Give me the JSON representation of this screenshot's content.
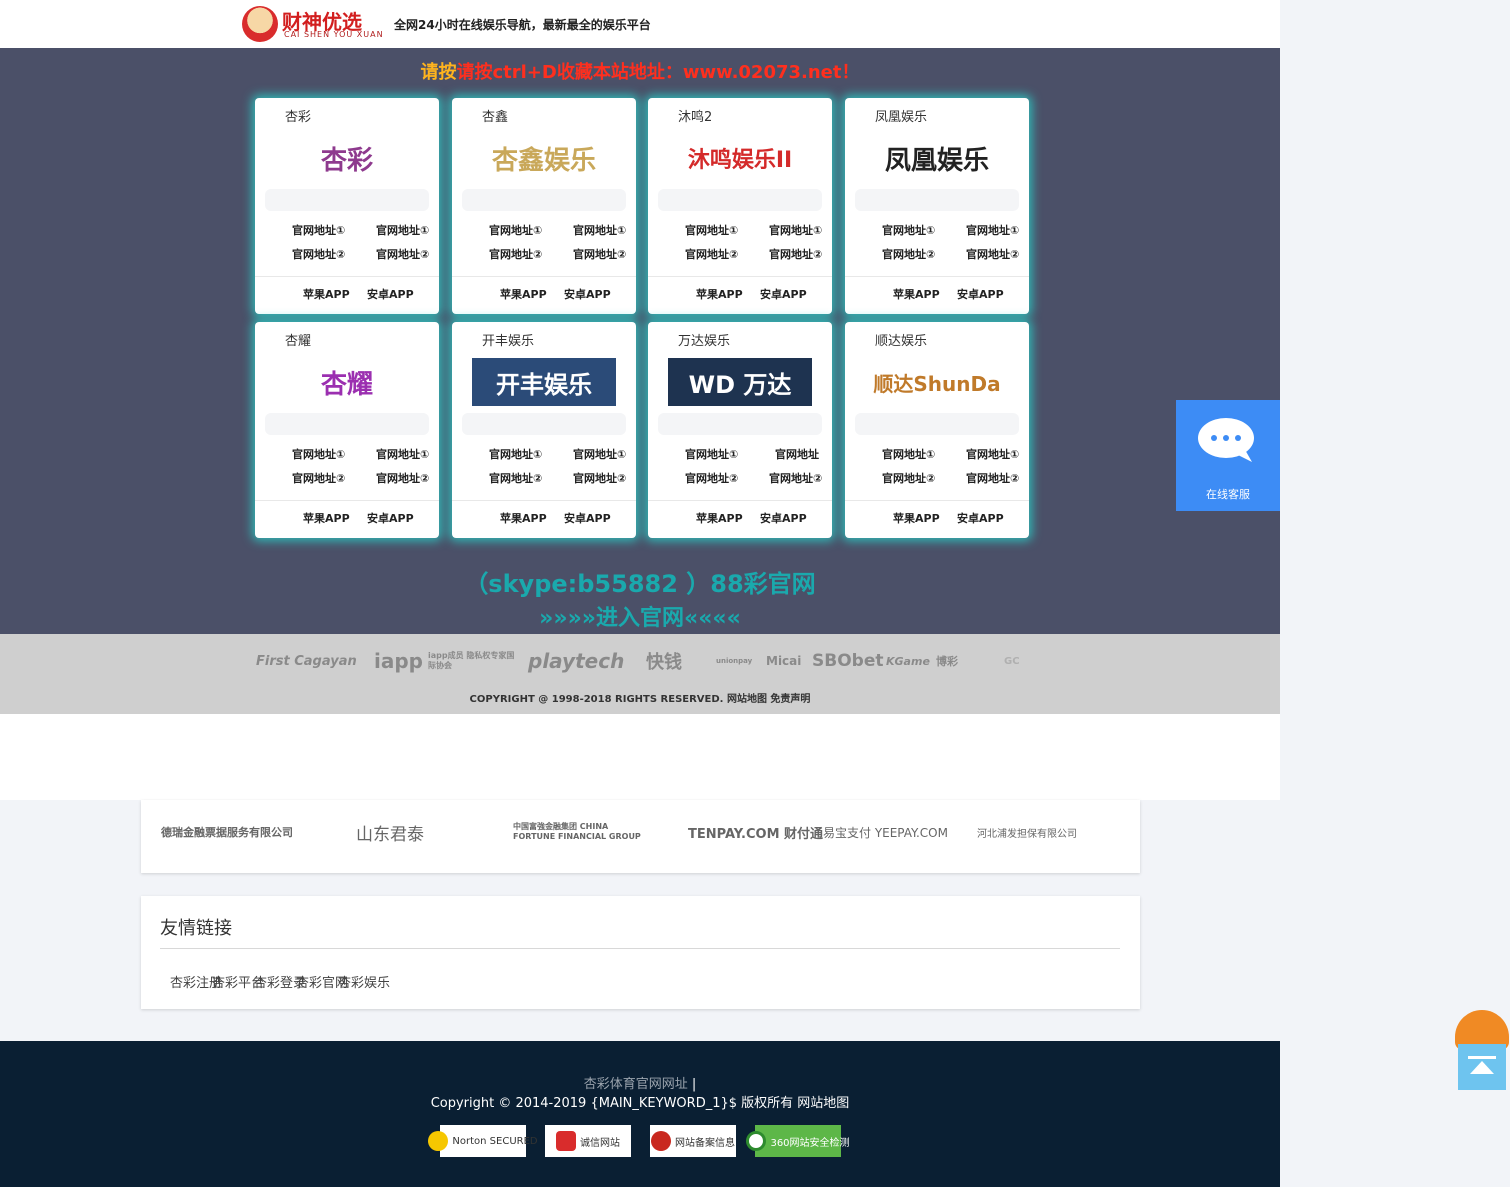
{
  "header": {
    "logo_text": "财神优选",
    "logo_sub": "CAI SHEN YOU XUAN",
    "tagline": "全网24小时在线娱乐导航，最新最全的娱乐平台"
  },
  "notice": {
    "part1": "请按",
    "part2": "请按ctrl+D收藏本站地址：www.02073.net！"
  },
  "cards": [
    {
      "name": "杏彩",
      "logo": "杏彩",
      "l1": "官网地址①",
      "l2": "官网地址①",
      "l3": "官网地址②",
      "l4": "官网地址②",
      "app1": "苹果APP",
      "app2": "安卓APP",
      "color": "#8e3a8e"
    },
    {
      "name": "杏鑫",
      "logo": "杏鑫娱乐",
      "l1": "官网地址①",
      "l2": "官网地址①",
      "l3": "官网地址②",
      "l4": "官网地址②",
      "app1": "苹果APP",
      "app2": "安卓APP",
      "color": "#c9a85a"
    },
    {
      "name": "沐鸣2",
      "logo": "沐鸣娱乐II",
      "l1": "官网地址①",
      "l2": "官网地址①",
      "l3": "官网地址②",
      "l4": "官网地址②",
      "app1": "苹果APP",
      "app2": "安卓APP",
      "color": "#d42a2a"
    },
    {
      "name": "凤凰娱乐",
      "logo": "凤凰娱乐",
      "l1": "官网地址①",
      "l2": "官网地址①",
      "l3": "官网地址②",
      "l4": "官网地址②",
      "app1": "苹果APP",
      "app2": "安卓APP",
      "color": "#222222"
    },
    {
      "name": "杏耀",
      "logo": "杏耀",
      "l1": "官网地址①",
      "l2": "官网地址①",
      "l3": "官网地址②",
      "l4": "官网地址②",
      "app1": "苹果APP",
      "app2": "安卓APP",
      "color": "#9b2fb0"
    },
    {
      "name": "开丰娱乐",
      "logo": "开丰娱乐",
      "l1": "官网地址①",
      "l2": "官网地址①",
      "l3": "官网地址②",
      "l4": "官网地址②",
      "app1": "苹果APP",
      "app2": "安卓APP",
      "color": "#ffffff"
    },
    {
      "name": "万达娱乐",
      "logo": "WD 万达",
      "l1": "官网地址①",
      "l2": "官网地址",
      "l3": "官网地址②",
      "l4": "官网地址②",
      "app1": "苹果APP",
      "app2": "安卓APP",
      "color": "#ffffff"
    },
    {
      "name": "顺达娱乐",
      "logo": "顺达ShunDa",
      "l1": "官网地址①",
      "l2": "官网地址①",
      "l3": "官网地址②",
      "l4": "官网地址②",
      "app1": "苹果APP",
      "app2": "安卓APP",
      "color": "#c07a2a"
    }
  ],
  "contact": {
    "skype": "（skype:b55882 ）88彩官网",
    "enter": "»»»»进入官网««««"
  },
  "partner_logos": [
    "First Cagayan",
    "iapp",
    "iapp成员 隐私权专家国际协会",
    "playtech",
    "快钱",
    "unionpay",
    "Micai",
    "SBObet",
    "KGame",
    "博彩",
    "GC"
  ],
  "copyright1": "COPYRIGHT @ 1998-2018 RIGHTS RESERVED. 网站地图 免责声明",
  "finance_logos": [
    "德瑞金融票据服务有限公司",
    "山东君泰",
    "中国富強金融集团 CHINA FORTUNE FINANCIAL GROUP",
    "TENPAY.COM 财付通",
    "易宝支付 YEEPAY.COM",
    "河北浦发担保有限公司"
  ],
  "friend_links": {
    "title": "友情链接",
    "items": [
      "杏彩注册",
      "杏彩平台",
      "杏彩登录",
      "杏彩官网",
      "杏彩娱乐"
    ]
  },
  "footer": {
    "link": "杏彩体育官网网址",
    "pipe": " |",
    "copyright": "Copyright © 2014-2019 {MAIN_KEYWORD_1}$ 版权所有 网站地图",
    "badges": [
      "Norton SECURED",
      "诚信网站",
      "网站备案信息",
      "360网站安全检测"
    ]
  },
  "service": {
    "label": "在线客服"
  }
}
